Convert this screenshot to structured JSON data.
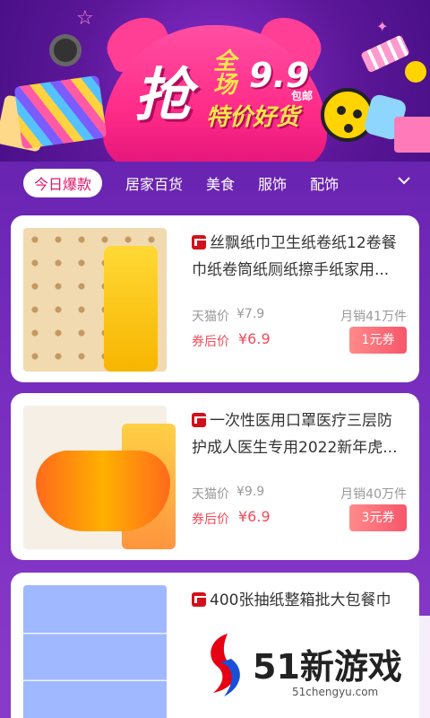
{
  "banner": {
    "grab": "抢",
    "promo_prefix": "全场",
    "promo_price": "9.9",
    "promo_shipping": "包邮",
    "promo_sub": "特价好货"
  },
  "tabs": [
    {
      "label": "今日爆款",
      "active": true
    },
    {
      "label": "居家百货",
      "active": false
    },
    {
      "label": "美食",
      "active": false
    },
    {
      "label": "服饰",
      "active": false
    },
    {
      "label": "配饰",
      "active": false
    }
  ],
  "products": [
    {
      "title": "丝飘纸巾卫生纸卷纸12卷餐巾纸卷筒纸厕纸擦手纸家用...",
      "orig_label": "天猫价",
      "orig_price": "¥7.9",
      "sales": "月销41万件",
      "after_label": "券后价",
      "after_price": "¥6.9",
      "coupon": "1元券"
    },
    {
      "title": "一次性医用口罩医疗三层防护成人医生专用2022新年虎...",
      "orig_label": "天猫价",
      "orig_price": "¥9.9",
      "sales": "月销40万件",
      "after_label": "券后价",
      "after_price": "¥6.9",
      "coupon": "3元券"
    },
    {
      "title": "400张抽纸整箱批大包餐巾",
      "orig_label": "",
      "orig_price": "",
      "sales": "",
      "after_label": "",
      "after_price": "",
      "coupon": ""
    }
  ],
  "watermark": {
    "text": "51新游戏",
    "url": "51chengyu.com"
  },
  "colors": {
    "accent": "#e0186b",
    "price": "#f14a5a",
    "tmall": "#d0111b"
  }
}
